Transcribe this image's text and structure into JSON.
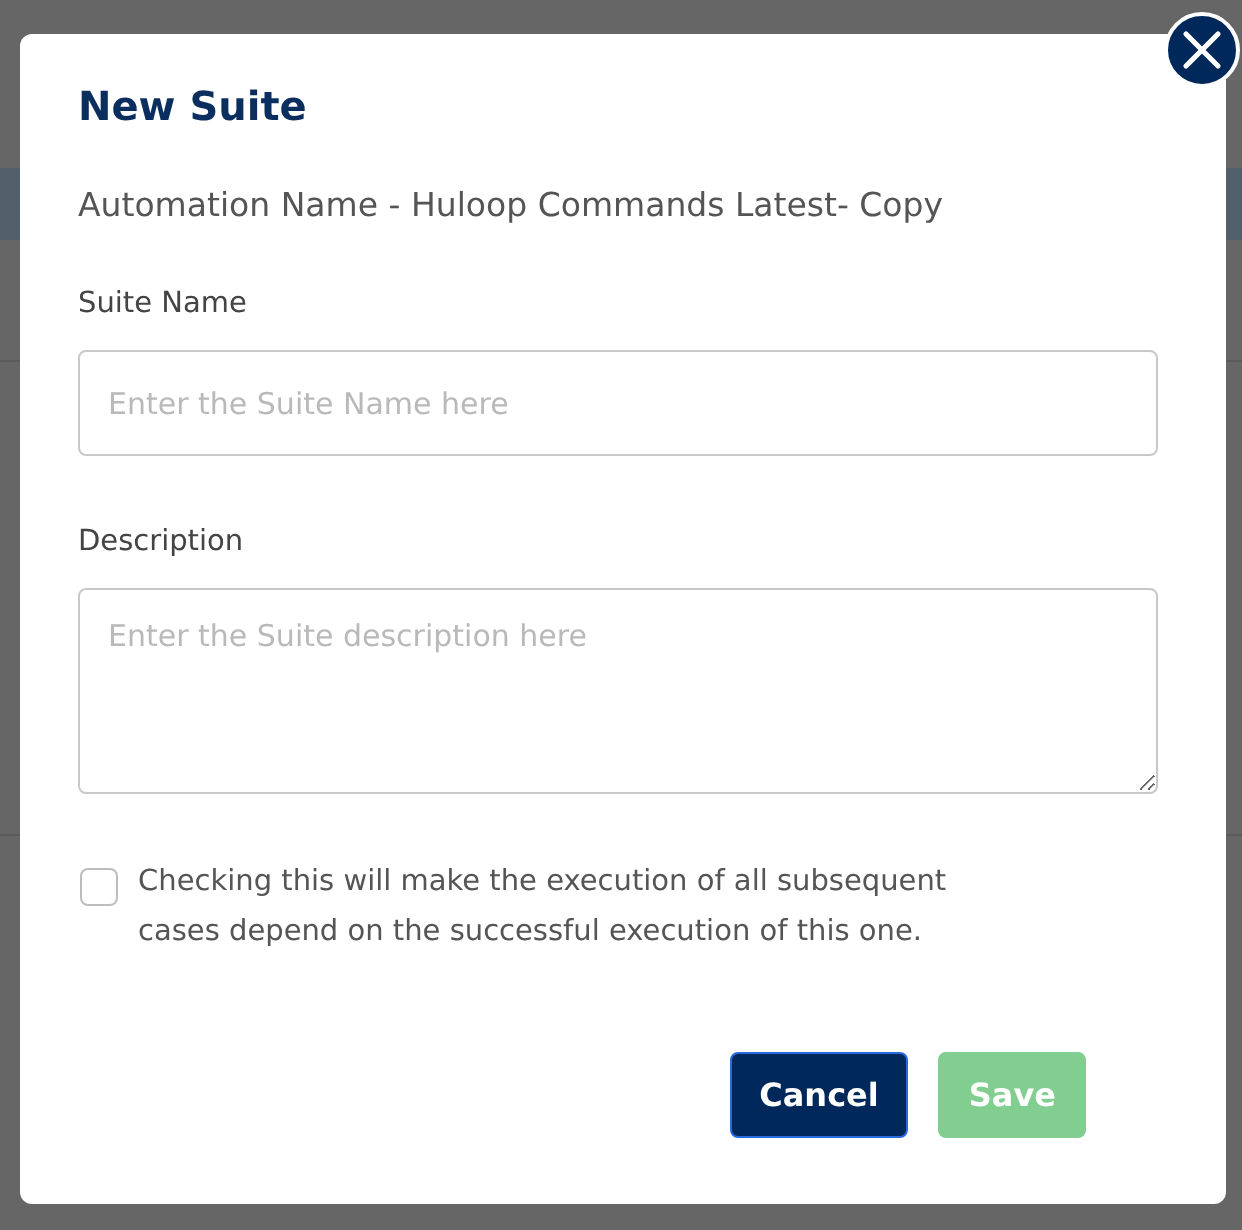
{
  "dialog": {
    "title": "New Suite",
    "subtitle": "Automation Name - Huloop Commands Latest- Copy"
  },
  "fields": [
    {
      "kind": "input",
      "label": "Suite Name",
      "placeholder": "Enter the Suite Name here"
    },
    {
      "kind": "textarea",
      "label": "Description",
      "placeholder": "Enter the Suite description here"
    }
  ],
  "dependency_checkbox": {
    "label": "Checking this will make the execution of all subsequent cases depend on the successful execution of this one.",
    "checked": false
  },
  "buttons": [
    {
      "kind": "cancel",
      "label": "Cancel",
      "disabled": false
    },
    {
      "kind": "save",
      "label": "Save",
      "disabled": true
    }
  ]
}
